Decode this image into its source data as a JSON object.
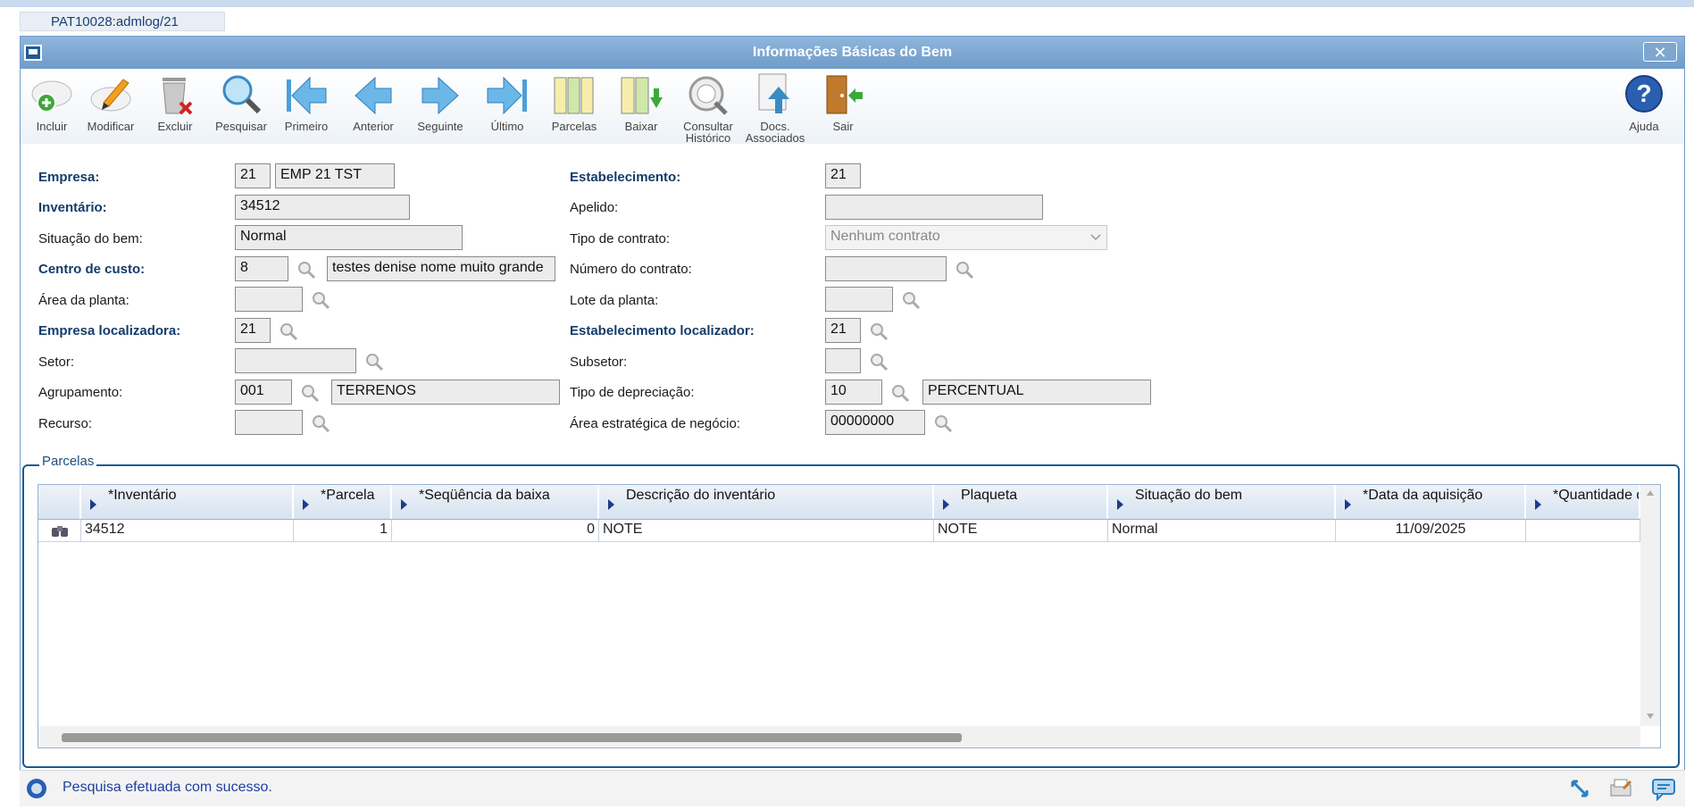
{
  "tab": {
    "label": "PAT10028:admlog/21"
  },
  "window": {
    "title": "Informações Básicas do Bem",
    "close_symbol": "✕"
  },
  "toolbar": {
    "buttons": [
      {
        "label": "Incluir"
      },
      {
        "label": "Modificar"
      },
      {
        "label": "Excluir"
      },
      {
        "label": "Pesquisar"
      },
      {
        "label": "Primeiro"
      },
      {
        "label": "Anterior"
      },
      {
        "label": "Seguinte"
      },
      {
        "label": "Último"
      },
      {
        "label": "Parcelas"
      },
      {
        "label": "Baixar"
      },
      {
        "label": "Consultar",
        "label2": "Histórico"
      },
      {
        "label": "Docs.",
        "label2": "Associados"
      },
      {
        "label": "Sair"
      }
    ],
    "help": {
      "label": "Ajuda",
      "symbol": "?"
    }
  },
  "form": {
    "empresa": {
      "label": "Empresa:",
      "code": "21",
      "name": "EMP 21 TST"
    },
    "inventario": {
      "label": "Inventário:",
      "value": "34512"
    },
    "situacao": {
      "label": "Situação do bem:",
      "value": "Normal"
    },
    "centro_custo": {
      "label": "Centro de custo:",
      "code": "8",
      "name": "testes denise nome muito grande"
    },
    "area_planta": {
      "label": "Área da planta:",
      "value": ""
    },
    "empresa_localizadora": {
      "label": "Empresa localizadora:",
      "value": "21"
    },
    "setor": {
      "label": "Setor:",
      "value": ""
    },
    "agrupamento": {
      "label": "Agrupamento:",
      "code": "001",
      "name": "TERRENOS"
    },
    "recurso": {
      "label": "Recurso:",
      "value": ""
    },
    "estabelecimento": {
      "label": "Estabelecimento:",
      "value": "21"
    },
    "apelido": {
      "label": "Apelido:",
      "value": ""
    },
    "tipo_contrato": {
      "label": "Tipo de contrato:",
      "value": "Nenhum contrato"
    },
    "numero_contrato": {
      "label": "Número do contrato:",
      "value": ""
    },
    "lote_planta": {
      "label": "Lote da planta:",
      "value": ""
    },
    "estab_localizador": {
      "label": "Estabelecimento localizador:",
      "value": "21"
    },
    "subsetor": {
      "label": "Subsetor:",
      "value": ""
    },
    "tipo_depreciacao": {
      "label": "Tipo de depreciação:",
      "code": "10",
      "name": "PERCENTUAL"
    },
    "area_estrategica": {
      "label": "Área estratégica de negócio:",
      "value": "00000000"
    }
  },
  "parcelas": {
    "legend": "Parcelas",
    "columns": [
      "*Inventário",
      "*Parcela",
      "*Seqüência da baixa",
      "Descrição do inventário",
      "Plaqueta",
      "Situação do bem",
      "*Data da aquisição",
      "*Quantidade de me"
    ],
    "rows": [
      [
        "34512",
        "1",
        "0",
        "NOTE",
        "NOTE",
        "Normal",
        "11/09/2025",
        ""
      ]
    ]
  },
  "status": {
    "message": "Pesquisa efetuada com sucesso."
  },
  "colors": {
    "accent": "#1e5a8e",
    "title_bar": "#7ea6cf",
    "label_bold": "#143c6a"
  }
}
